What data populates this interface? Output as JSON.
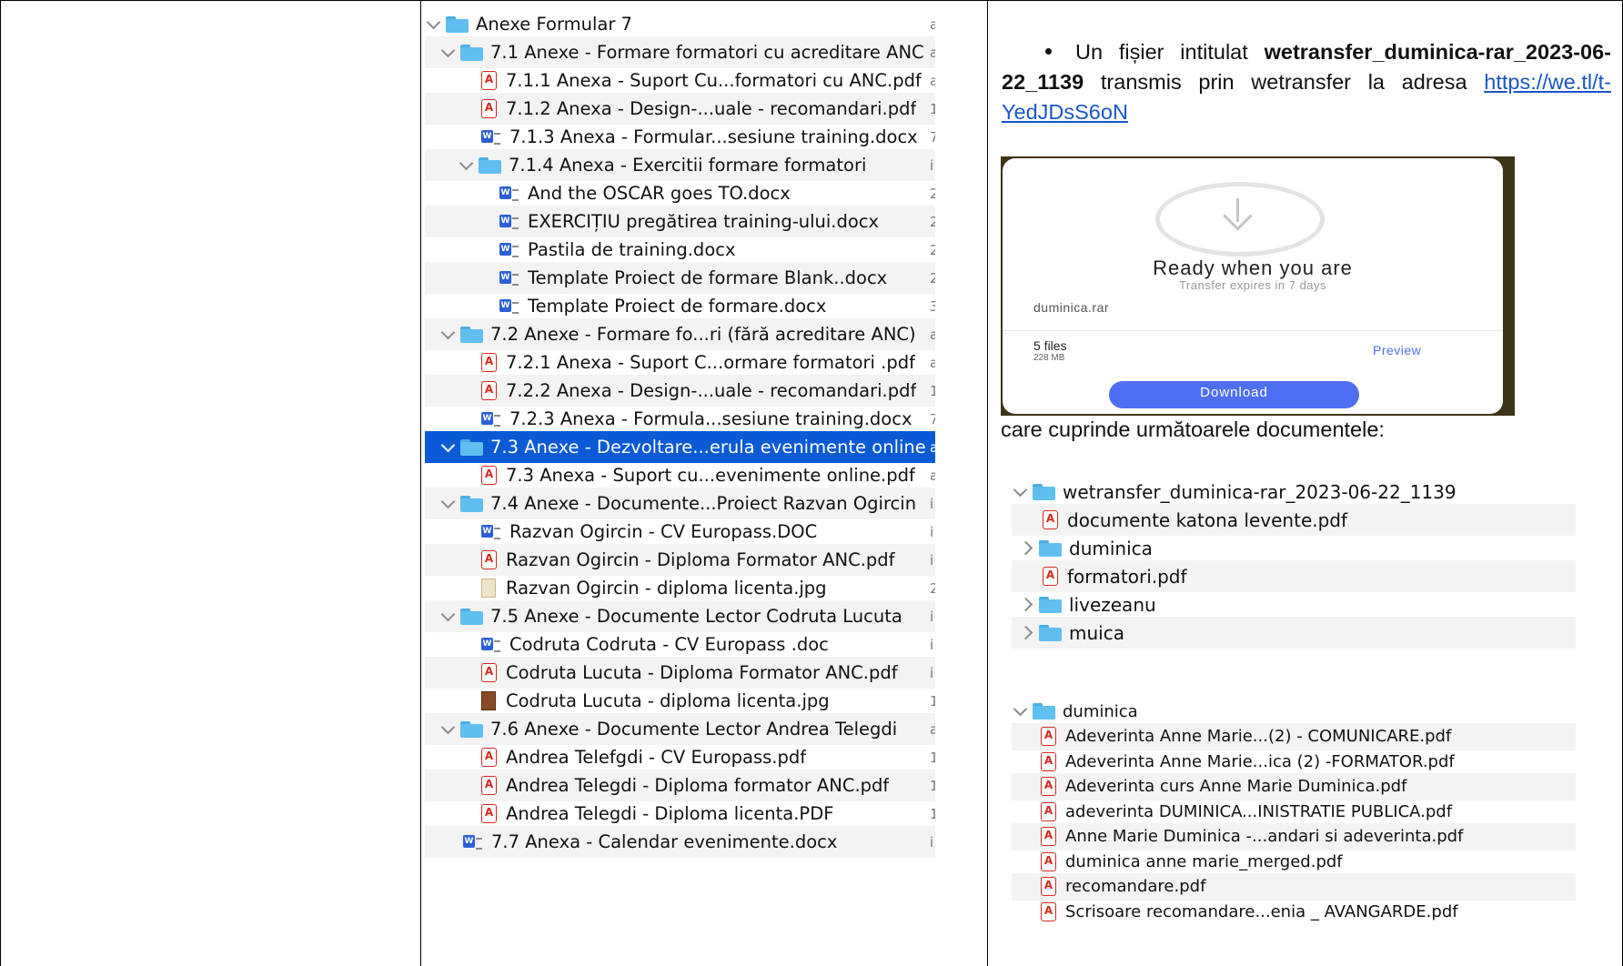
{
  "finder_tree": {
    "rows": [
      {
        "indent": 0,
        "expand": "open",
        "icon": "folder",
        "label": "Anexe Formular 7",
        "trail": "a"
      },
      {
        "indent": 1,
        "expand": "open",
        "icon": "folder",
        "label": "7.1 Anexe - Formare formatori cu acreditare ANC",
        "trail": "a"
      },
      {
        "indent": 2,
        "expand": "none",
        "icon": "pdf",
        "label": "7.1.1 Anexa - Suport Cu...formatori cu ANC.pdf",
        "trail": "a"
      },
      {
        "indent": 2,
        "expand": "none",
        "icon": "pdf",
        "label": "7.1.2 Anexa - Design-...uale - recomandari.pdf",
        "trail": "1"
      },
      {
        "indent": 2,
        "expand": "none",
        "icon": "docx",
        "label": "7.1.3 Anexa - Formular...sesiune training.docx",
        "trail": "7"
      },
      {
        "indent": 2,
        "expand": "open",
        "icon": "folder",
        "label": "7.1.4 Anexa - Exercitii formare formatori",
        "trail": "i"
      },
      {
        "indent": 3,
        "expand": "none",
        "icon": "docx",
        "label": "And the OSCAR goes TO.docx",
        "trail": "2"
      },
      {
        "indent": 3,
        "expand": "none",
        "icon": "docx",
        "label": "EXERCIȚIU pregătirea training-ului.docx",
        "trail": "2"
      },
      {
        "indent": 3,
        "expand": "none",
        "icon": "docx",
        "label": "Pastila de training.docx",
        "trail": "2"
      },
      {
        "indent": 3,
        "expand": "none",
        "icon": "docx",
        "label": "Template Proiect de formare Blank..docx",
        "trail": "2"
      },
      {
        "indent": 3,
        "expand": "none",
        "icon": "docx",
        "label": "Template Proiect de formare.docx",
        "trail": "3"
      },
      {
        "indent": 1,
        "expand": "open",
        "icon": "folder",
        "label": "7.2 Anexe - Formare fo...ri (fără acreditare ANC)",
        "trail": "a"
      },
      {
        "indent": 2,
        "expand": "none",
        "icon": "pdf",
        "label": "7.2.1 Anexa - Suport C...ormare formatori .pdf",
        "trail": "a"
      },
      {
        "indent": 2,
        "expand": "none",
        "icon": "pdf",
        "label": "7.2.2 Anexa - Design-...uale - recomandari.pdf",
        "trail": "1"
      },
      {
        "indent": 2,
        "expand": "none",
        "icon": "docx",
        "label": "7.2.3 Anexa - Formula...sesiune training.docx",
        "trail": "7"
      },
      {
        "indent": 1,
        "expand": "open",
        "icon": "folder",
        "label": "7.3 Anexe - Dezvoltare...erula evenimente online",
        "trail": "a",
        "selected": true
      },
      {
        "indent": 2,
        "expand": "none",
        "icon": "pdf",
        "label": "7.3 Anexa - Suport cu...evenimente online.pdf",
        "trail": "a"
      },
      {
        "indent": 1,
        "expand": "open",
        "icon": "folder",
        "label": "7.4 Anexe - Documente...Proiect Razvan Ogircin",
        "trail": "i"
      },
      {
        "indent": 2,
        "expand": "none",
        "icon": "docx",
        "label": "Razvan Ogircin - CV Europass.DOC",
        "trail": "i"
      },
      {
        "indent": 2,
        "expand": "none",
        "icon": "pdf",
        "label": "Razvan Ogircin - Diploma Formator ANC.pdf",
        "trail": "i"
      },
      {
        "indent": 2,
        "expand": "none",
        "icon": "jpg",
        "label": "Razvan Ogircin - diploma licenta.jpg",
        "trail": "2"
      },
      {
        "indent": 1,
        "expand": "open",
        "icon": "folder",
        "label": "7.5 Anexe - Documente Lector Codruta Lucuta",
        "trail": "i"
      },
      {
        "indent": 2,
        "expand": "none",
        "icon": "docx",
        "label": "Codruta Codruta - CV Europass .doc",
        "trail": "i"
      },
      {
        "indent": 2,
        "expand": "none",
        "icon": "pdf",
        "label": "Codruta Lucuta - Diploma Formator ANC.pdf",
        "trail": "i"
      },
      {
        "indent": 2,
        "expand": "none",
        "icon": "jpg-dark",
        "label": "Codruta Lucuta - diploma licenta.jpg",
        "trail": "1"
      },
      {
        "indent": 1,
        "expand": "open",
        "icon": "folder",
        "label": "7.6 Anexe - Documente Lector Andrea Telegdi",
        "trail": "a"
      },
      {
        "indent": 2,
        "expand": "none",
        "icon": "pdf",
        "label": "Andrea Telefgdi - CV Europass.pdf",
        "trail": "1"
      },
      {
        "indent": 2,
        "expand": "none",
        "icon": "pdf",
        "label": "Andrea Telegdi - Diploma formator ANC.pdf",
        "trail": "1"
      },
      {
        "indent": 2,
        "expand": "none",
        "icon": "pdf",
        "label": "Andrea Telegdi - Diploma licenta.PDF",
        "trail": "1"
      },
      {
        "indent": 1,
        "expand": "none",
        "icon": "docx",
        "label": "7.7 Anexa - Calendar evenimente.docx",
        "trail": "i"
      }
    ]
  },
  "bullet": {
    "prefix": "Un fișier intitulat ",
    "filename": "wetransfer_duminica-rar_2023-06-22_1139",
    "middle": " transmis prin wetransfer la adresa ",
    "link": "https://we.tl/t-YedJDsS6oN"
  },
  "wetransfer": {
    "title": "Ready when you are",
    "subtitle": "Transfer expires in 7 days",
    "filename": "duminica.rar",
    "files": "5 files",
    "size": "228 MB",
    "preview": "Preview",
    "download": "Download"
  },
  "caption": "care cuprinde următoarele  documentele:",
  "list1": [
    {
      "indent": 0,
      "expand": "open",
      "icon": "folder",
      "label": "wetransfer_duminica-rar_2023-06-22_1139"
    },
    {
      "indent": 1,
      "expand": "none",
      "icon": "pdf",
      "label": "documente katona levente.pdf"
    },
    {
      "indent": 1,
      "expand": "closed",
      "icon": "folder",
      "label": "duminica"
    },
    {
      "indent": 1,
      "expand": "none",
      "icon": "pdf",
      "label": "formatori.pdf"
    },
    {
      "indent": 1,
      "expand": "closed",
      "icon": "folder",
      "label": "livezeanu"
    },
    {
      "indent": 1,
      "expand": "closed",
      "icon": "folder",
      "label": "muica"
    }
  ],
  "list2": [
    {
      "indent": 0,
      "expand": "open",
      "icon": "folder",
      "label": "duminica"
    },
    {
      "indent": 1,
      "expand": "none",
      "icon": "pdf",
      "label": "Adeverinta Anne Marie...(2) - COMUNICARE.pdf"
    },
    {
      "indent": 1,
      "expand": "none",
      "icon": "pdf",
      "label": "Adeverinta Anne Marie...ica (2) -FORMATOR.pdf"
    },
    {
      "indent": 1,
      "expand": "none",
      "icon": "pdf",
      "label": "Adeverinta curs Anne Marie Duminica.pdf"
    },
    {
      "indent": 1,
      "expand": "none",
      "icon": "pdf",
      "label": "adeverinta DUMINICA...INISTRATIE PUBLICA.pdf"
    },
    {
      "indent": 1,
      "expand": "none",
      "icon": "pdf",
      "label": "Anne Marie Duminica -...andari si adeverinta.pdf"
    },
    {
      "indent": 1,
      "expand": "none",
      "icon": "pdf",
      "label": "duminica anne marie_merged.pdf"
    },
    {
      "indent": 1,
      "expand": "none",
      "icon": "pdf",
      "label": "recomandare.pdf"
    },
    {
      "indent": 1,
      "expand": "none",
      "icon": "pdf",
      "label": "Scrisoare recomandare...enia _ AVANGARDE.pdf"
    }
  ]
}
